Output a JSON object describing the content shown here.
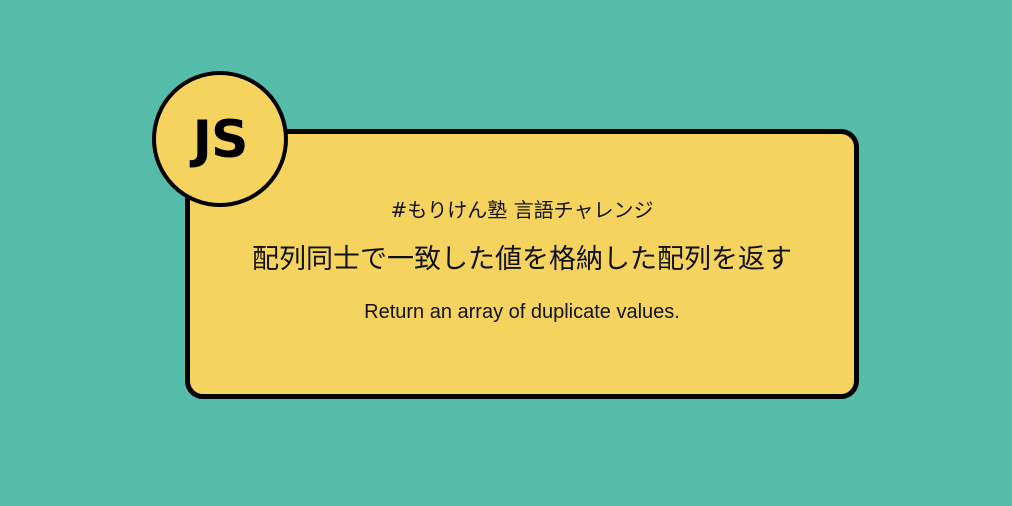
{
  "badge": {
    "label": "JS"
  },
  "card": {
    "tag": "#もりけん塾 言語チャレンジ",
    "title_ja": "配列同士で一致した値を格納した配列を返す",
    "title_en": "Return an array of duplicate values."
  },
  "colors": {
    "background": "#56bcaa",
    "card": "#f4d35e",
    "border": "#000000"
  }
}
